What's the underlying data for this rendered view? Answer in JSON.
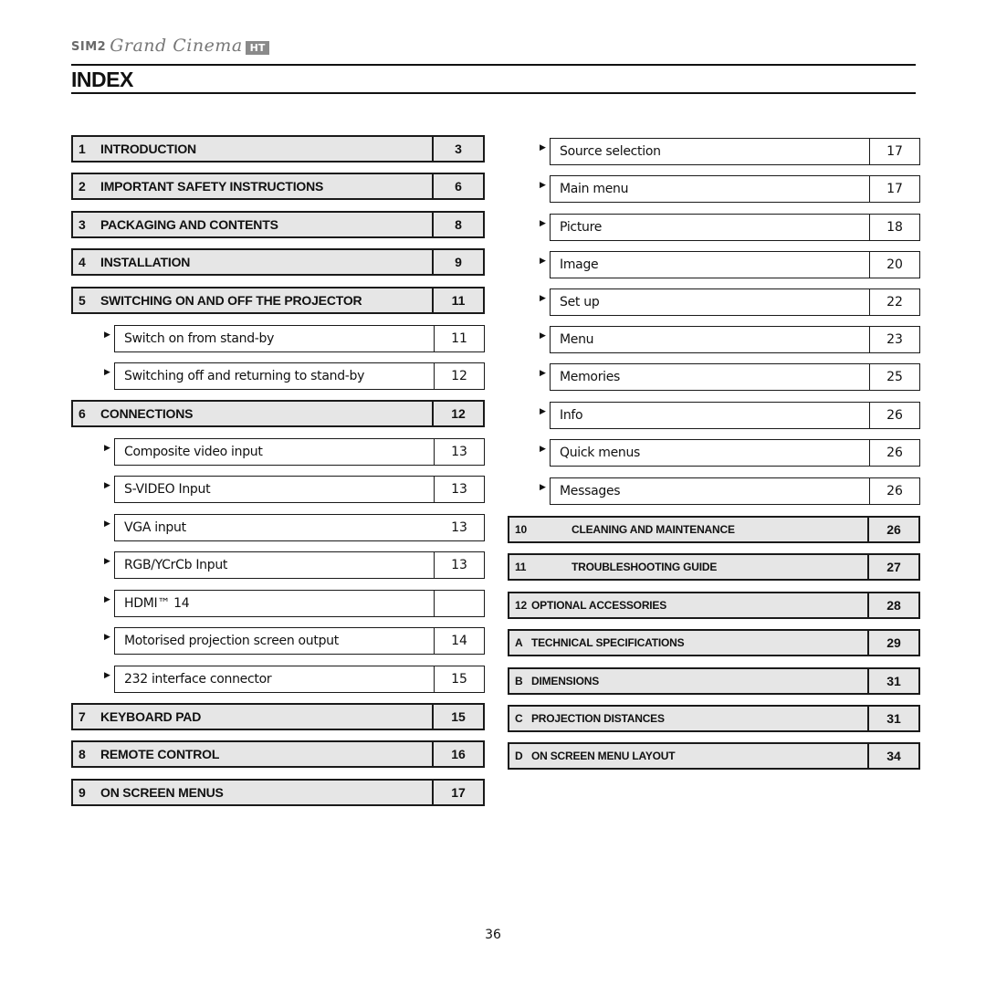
{
  "header": {
    "logo": {
      "brand": "SIM2",
      "product": "Grand Cinema",
      "badge": "HT"
    },
    "title": "INDEX"
  },
  "left_column": [
    {
      "type": "head",
      "num": "1",
      "label": "INTRODUCTION",
      "page": "3"
    },
    {
      "type": "head",
      "num": "2",
      "label": "IMPORTANT SAFETY INSTRUCTIONS",
      "page": "6"
    },
    {
      "type": "head",
      "num": "3",
      "label": "PACKAGING AND CONTENTS",
      "page": "8"
    },
    {
      "type": "head",
      "num": "4",
      "label": "INSTALLATION",
      "page": "9"
    },
    {
      "type": "head",
      "num": "5",
      "label": "SWITCHING ON AND OFF THE PROJECTOR",
      "page": "11"
    },
    {
      "type": "sub",
      "label": "Switch on from stand-by",
      "page": "11"
    },
    {
      "type": "sub",
      "label": "Switching off and returning to stand-by",
      "page": "12"
    },
    {
      "type": "head",
      "num": "6",
      "label": "CONNECTIONS",
      "page": "12"
    },
    {
      "type": "sub",
      "label": "Composite video input",
      "page": "13"
    },
    {
      "type": "sub",
      "label": "S-VIDEO Input",
      "page": "13"
    },
    {
      "type": "sub",
      "label": "VGA input",
      "page": "13"
    },
    {
      "type": "sub",
      "label": "RGB/YCrCb Input",
      "page": "13"
    },
    {
      "type": "sub",
      "label": "HDMI™ 14",
      "page": ""
    },
    {
      "type": "sub",
      "label": "Motorised projection screen output",
      "page": "14"
    },
    {
      "type": "sub",
      "label": "232 interface connector",
      "page": "15"
    },
    {
      "type": "head",
      "num": "7",
      "label": "KEYBOARD PAD",
      "page": "15"
    },
    {
      "type": "head",
      "num": "8",
      "label": "REMOTE CONTROL",
      "page": "16"
    },
    {
      "type": "head",
      "num": "9",
      "label": "ON SCREEN MENUS",
      "page": "17"
    }
  ],
  "right_column": [
    {
      "type": "sub",
      "label": "Source selection",
      "page": "17"
    },
    {
      "type": "sub",
      "label": "Main menu",
      "page": "17"
    },
    {
      "type": "sub",
      "label": "Picture",
      "page": "18"
    },
    {
      "type": "sub",
      "label": "Image",
      "page": "20"
    },
    {
      "type": "sub",
      "label": "Set up",
      "page": "22"
    },
    {
      "type": "sub",
      "label": "Menu",
      "page": "23"
    },
    {
      "type": "sub",
      "label": "Memories",
      "page": "25"
    },
    {
      "type": "sub",
      "label": "Info",
      "page": "26"
    },
    {
      "type": "sub",
      "label": "Quick menus",
      "page": "26"
    },
    {
      "type": "sub",
      "label": "Messages",
      "page": "26"
    },
    {
      "type": "head",
      "num": "10",
      "label": "CLEANING AND MAINTENANCE",
      "page": "26"
    },
    {
      "type": "head",
      "num": "11",
      "label": "TROUBLESHOOTING GUIDE",
      "page": "27"
    },
    {
      "type": "head",
      "num": "12",
      "label": "OPTIONAL ACCESSORIES",
      "page": "28"
    },
    {
      "type": "head",
      "num": "A",
      "label": "TECHNICAL SPECIFICATIONS",
      "page": "29"
    },
    {
      "type": "head",
      "num": "B",
      "label": "DIMENSIONS",
      "page": "31"
    },
    {
      "type": "head",
      "num": "C",
      "label": "PROJECTION DISTANCES",
      "page": "31"
    },
    {
      "type": "head",
      "num": "D",
      "label": "ON SCREEN MENU LAYOUT",
      "page": "34"
    }
  ],
  "footer": {
    "page_number": "36"
  }
}
